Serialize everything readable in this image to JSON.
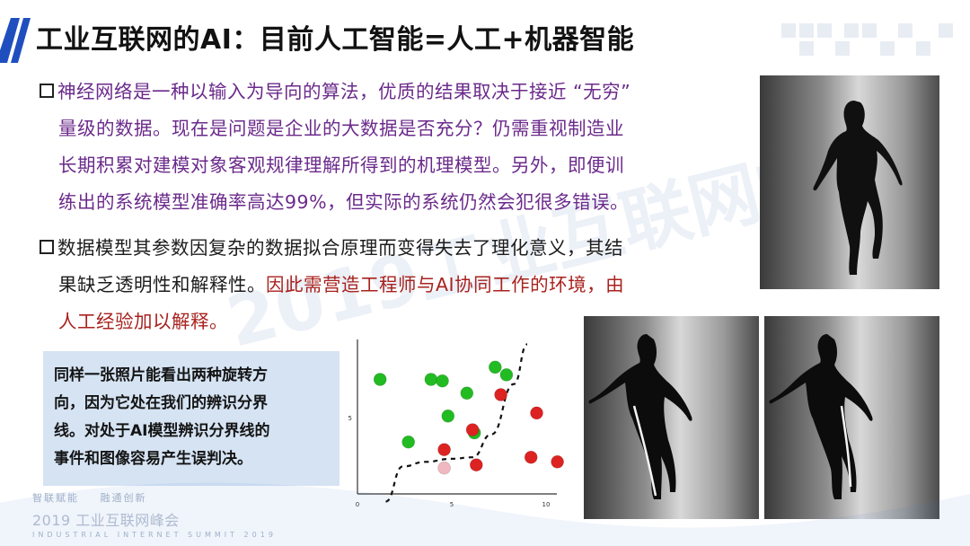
{
  "title": "工业互联网的AI：目前人工智能=人工+机器智能",
  "bullets": [
    {
      "lines": [
        "神经网络是一种以输入为导向的算法，优质的结果取决于接近 “无穷”",
        "量级的数据。现在是问题是企业的大数据是否充分？仍需重视制造业",
        "长期积累对建模对象客观规律理解所得到的机理模型。另外，即便训",
        "练出的系统模型准确率高达99%，但实际的系统仍然会犯很多错误。"
      ]
    },
    {
      "line1": "数据模型其参数因复杂的数据拟合原理而变得失去了理化意义，其结",
      "line2_dark": "果缺乏透明性和解释性。",
      "line2_red": "因此需营造工程师与AI协同工作的环境，由",
      "line3_red": "人工经验加以解释。"
    }
  ],
  "note": [
    "同样一张照片能看出两种旋转方",
    "向，因为它处在我们的辨识分界",
    "线。对处于AI模型辨识分界线的",
    "事件和图像容易产生误判决。"
  ],
  "chart_data": {
    "type": "scatter",
    "title": "",
    "xlabel": "",
    "ylabel": "",
    "xlim": [
      0,
      10
    ],
    "ylim": [
      0,
      10
    ],
    "x_ticks": [
      "0",
      "5",
      "10"
    ],
    "y_ticks": [
      "5"
    ],
    "series": [
      {
        "color": "#22bb22",
        "points": [
          [
            1.2,
            7.5
          ],
          [
            2.7,
            3.4
          ],
          [
            3.9,
            7.5
          ],
          [
            4.5,
            7.4
          ],
          [
            4.8,
            5.1
          ],
          [
            5.8,
            6.6
          ],
          [
            6.2,
            4.0
          ],
          [
            7.3,
            8.3
          ],
          [
            7.9,
            7.8
          ]
        ]
      },
      {
        "color": "#dd2222",
        "points": [
          [
            4.6,
            2.9
          ],
          [
            6.1,
            4.2
          ],
          [
            6.3,
            1.9
          ],
          [
            7.6,
            6.5
          ],
          [
            9.5,
            5.3
          ],
          [
            9.2,
            2.4
          ],
          [
            10.6,
            2.1
          ]
        ]
      },
      {
        "color": "#f0b8c0",
        "points": [
          [
            4.6,
            1.7
          ]
        ]
      }
    ],
    "boundary": [
      [
        1.5,
        -0.5
      ],
      [
        2.4,
        1.8
      ],
      [
        3.6,
        2.1
      ],
      [
        5.0,
        2.3
      ],
      [
        6.1,
        2.4
      ],
      [
        7.1,
        3.9
      ],
      [
        8.3,
        7.2
      ],
      [
        9.0,
        9.8
      ]
    ]
  },
  "footer": {
    "tag1": "智联赋能",
    "tag2": "融通创新",
    "event": "2019 工业互联网峰会",
    "sub": "INDUSTRIAL INTERNET SUMMIT 2019"
  },
  "watermark": "2019工业互联网峰会",
  "colors": {
    "accent": "#1f4fbf",
    "purple": "#6b2a8b",
    "red": "#a8221e",
    "note_bg": "#d5e3f3"
  }
}
